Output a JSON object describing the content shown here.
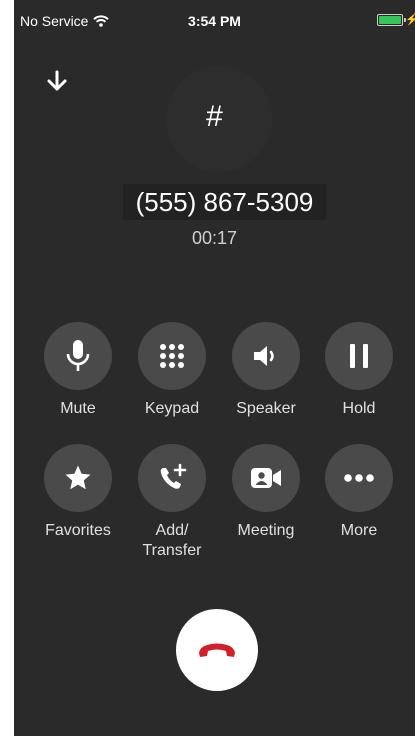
{
  "status_bar": {
    "carrier": "No Service",
    "time": "3:54 PM",
    "battery_level": 1.0
  },
  "call": {
    "avatar_text": "#",
    "number": "(555) 867-5309",
    "duration": "00:17"
  },
  "controls_row1": [
    {
      "id": "mute",
      "label": "Mute",
      "icon": "microphone-icon"
    },
    {
      "id": "keypad",
      "label": "Keypad",
      "icon": "keypad-grid-icon"
    },
    {
      "id": "speaker",
      "label": "Speaker",
      "icon": "speaker-icon"
    },
    {
      "id": "hold",
      "label": "Hold",
      "icon": "pause-icon"
    }
  ],
  "controls_row2": [
    {
      "id": "favorites",
      "label": "Favorites",
      "icon": "star-icon"
    },
    {
      "id": "add-transfer",
      "label_line1": "Add/",
      "label_line2": "Transfer",
      "icon": "phone-plus-icon"
    },
    {
      "id": "meeting",
      "label": "Meeting",
      "icon": "video-camera-icon"
    },
    {
      "id": "more",
      "label": "More",
      "icon": "ellipsis-icon"
    }
  ],
  "colors": {
    "background": "#2a2a2a",
    "button": "#4a4a4a",
    "hangup_bg": "#ffffff",
    "hangup_icon": "#d21f2a",
    "battery": "#33c759"
  }
}
